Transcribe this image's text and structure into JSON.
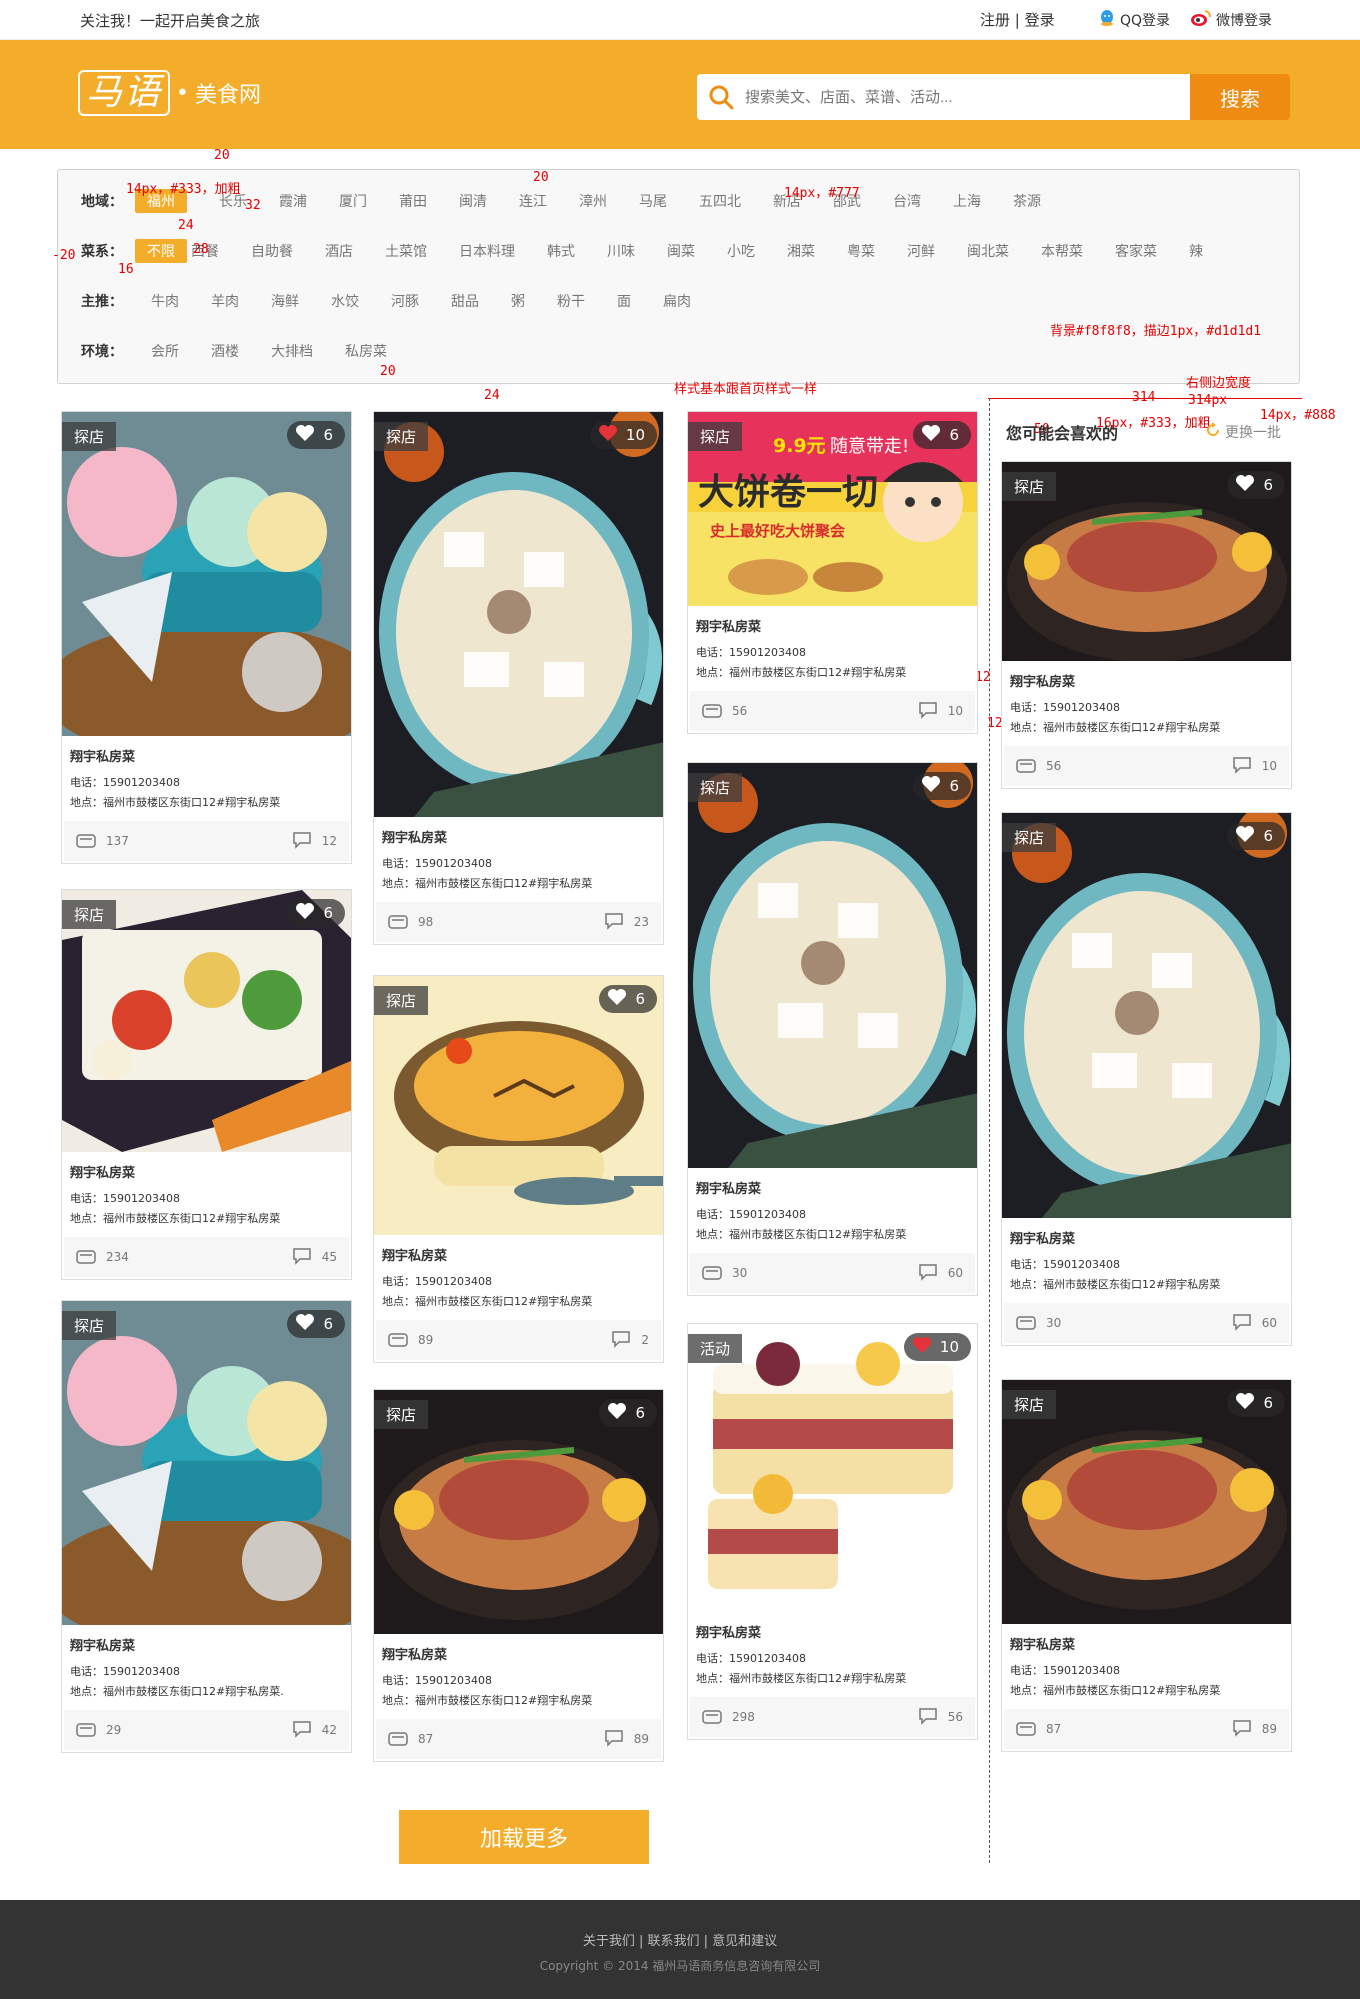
{
  "topbar": {
    "slogan": "关注我！一起开启美食之旅",
    "auth": "注册 | 登录",
    "qq_login": "QQ登录",
    "weibo_login": "微博登录"
  },
  "header": {
    "logo_mark": "马语",
    "site_name": "美食网",
    "search_placeholder": "搜索美文、店面、菜谱、活动...",
    "search_button": "搜索"
  },
  "filters": {
    "region": {
      "label": "地域：",
      "options": [
        "福州",
        "长乐",
        "霞浦",
        "厦门",
        "莆田",
        "闽清",
        "连江",
        "漳州",
        "马尾",
        "五四北",
        "新店",
        "邵武",
        "台湾",
        "上海",
        "茶源"
      ],
      "active": 0
    },
    "cuisine": {
      "label": "菜系：",
      "options": [
        "不限",
        "西餐",
        "自助餐",
        "酒店",
        "土菜馆",
        "日本料理",
        "韩式",
        "川味",
        "闽菜",
        "小吃",
        "湘菜",
        "粤菜",
        "河鲜",
        "闽北菜",
        "本帮菜",
        "客家菜",
        "辣"
      ],
      "active": 0
    },
    "staple": {
      "label": "主推：",
      "options": [
        "牛肉",
        "羊肉",
        "海鲜",
        "水饺",
        "河豚",
        "甜品",
        "粥",
        "粉干",
        "面",
        "扁肉"
      ]
    },
    "environment": {
      "label": "环境：",
      "options": [
        "会所",
        "酒楼",
        "大排档",
        "私房菜"
      ]
    }
  },
  "annotations": {
    "a1": "20",
    "a2": "14px，#333，加粗",
    "a3": "20",
    "a4": "14px，#777",
    "a5": "32",
    "a6": "24",
    "a7": "28",
    "a8": "-20",
    "a9": "16",
    "a10": "背景#f8f8f8，描边1px，#d1d1d1",
    "a11": "20",
    "a12": "24",
    "a13": "样式基本跟首页样式一样",
    "a14": "314",
    "a15": "右侧边宽度",
    "a16": "314px",
    "a17": "16px，#333，加粗",
    "a18": "14px，#888",
    "a19": "50",
    "a20": "12",
    "a21": "12"
  },
  "cards": [
    {
      "tag": "探店",
      "likes": "6",
      "name": "翔宇私房菜",
      "phone": "电话：15901203408",
      "address": "地点：福州市鼓楼区东街口12#翔宇私房菜",
      "views": "137",
      "comments": "12"
    },
    {
      "tag": "探店",
      "likes": "6",
      "name": "翔宇私房菜",
      "phone": "电话：15901203408",
      "address": "地点：福州市鼓楼区东街口12#翔宇私房菜",
      "views": "234",
      "comments": "45"
    },
    {
      "tag": "探店",
      "likes": "6",
      "name": "翔宇私房菜",
      "phone": "电话：15901203408",
      "address": "地点：福州市鼓楼区东街口12#翔宇私房菜.",
      "views": "29",
      "comments": "42"
    },
    {
      "tag": "探店",
      "likes": "10",
      "name": "翔宇私房菜",
      "phone": "电话：15901203408",
      "address": "地点：福州市鼓楼区东街口12#翔宇私房菜",
      "views": "98",
      "comments": "23"
    },
    {
      "tag": "探店",
      "likes": "6",
      "name": "翔宇私房菜",
      "phone": "电话：15901203408",
      "address": "地点：福州市鼓楼区东街口12#翔宇私房菜",
      "views": "89",
      "comments": "2"
    },
    {
      "tag": "探店",
      "likes": "6",
      "name": "翔宇私房菜",
      "phone": "电话：15901203408",
      "address": "地点：福州市鼓楼区东街口12#翔宇私房菜",
      "views": "87",
      "comments": "89"
    },
    {
      "tag": "探店",
      "likes": "6",
      "name": "翔宇私房菜",
      "phone": "电话：15901203408",
      "address": "地点：福州市鼓楼区东街口12#翔宇私房菜",
      "views": "56",
      "comments": "10",
      "banner_price": "9.9元",
      "banner_text": "随意带走!",
      "banner_title": "大饼卷一切",
      "banner_sub": "史上最好吃大饼聚会"
    },
    {
      "tag": "探店",
      "likes": "6",
      "name": "翔宇私房菜",
      "phone": "电话：15901203408",
      "address": "地点：福州市鼓楼区东街口12#翔宇私房菜",
      "views": "30",
      "comments": "60"
    },
    {
      "tag": "活动",
      "likes": "10",
      "name": "翔宇私房菜",
      "phone": "电话：15901203408",
      "address": "地点：福州市鼓楼区东街口12#翔宇私房菜",
      "views": "298",
      "comments": "56"
    }
  ],
  "sidebar": {
    "title": "您可能会喜欢的",
    "refresh": "更换一批",
    "cards": [
      {
        "tag": "探店",
        "likes": "6",
        "name": "翔宇私房菜",
        "phone": "电话：15901203408",
        "address": "地点：福州市鼓楼区东街口12#翔宇私房菜",
        "views": "56",
        "comments": "10"
      },
      {
        "tag": "探店",
        "likes": "6",
        "name": "翔宇私房菜",
        "phone": "电话：15901203408",
        "address": "地点：福州市鼓楼区东街口12#翔宇私房菜",
        "views": "30",
        "comments": "60"
      },
      {
        "tag": "探店",
        "likes": "6",
        "name": "翔宇私房菜",
        "phone": "电话：15901203408",
        "address": "地点：福州市鼓楼区东街口12#翔宇私房菜",
        "views": "87",
        "comments": "89"
      }
    ]
  },
  "load_more": "加载更多",
  "footer": {
    "links": "关于我们 | 联系我们 | 意见和建议",
    "copyright": "Copyright © 2014 福州马语商务信息咨询有限公司"
  }
}
